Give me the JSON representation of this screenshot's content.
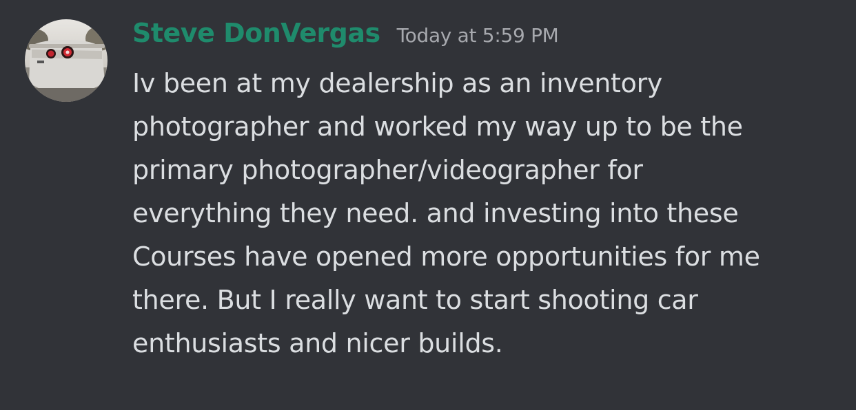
{
  "message": {
    "username": "Steve DonVergas",
    "timestamp": "Today at 5:59 PM",
    "lines": [
      "Iv been at my dealership as an inventory",
      "photographer and worked my way up to be the",
      "primary photographer/videographer for",
      "everything they need. and investing into these",
      "Courses have opened more opportunities for me",
      "there. But I really want to start shooting car",
      "enthusiasts and nicer builds."
    ],
    "username_color": "#1f8b6c",
    "avatar": "car-rear-photo-avatar"
  }
}
